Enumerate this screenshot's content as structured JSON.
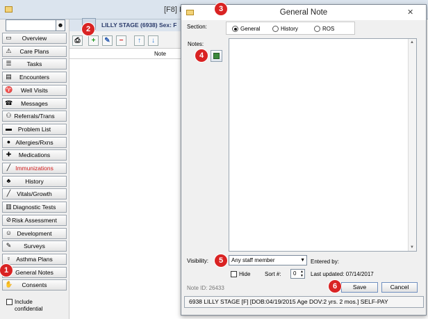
{
  "window": {
    "title": "[F8] L"
  },
  "sidebar": {
    "search_value": "",
    "items": [
      {
        "label": "Overview",
        "icon": "folder-icon",
        "color": "#000000"
      },
      {
        "label": "Care Plans",
        "icon": "warning-icon",
        "color": "#000000"
      },
      {
        "label": "Tasks",
        "icon": "task-list-icon",
        "color": "#000000"
      },
      {
        "label": "Encounters",
        "icon": "clipboard-icon",
        "color": "#000000"
      },
      {
        "label": "Well Visits",
        "icon": "stethoscope-icon",
        "color": "#000000"
      },
      {
        "label": "Messages",
        "icon": "phone-icon",
        "color": "#000000"
      },
      {
        "label": "Referrals/Trans",
        "icon": "people-icon",
        "color": "#000000"
      },
      {
        "label": "Problem List",
        "icon": "list-icon",
        "color": "#000000"
      },
      {
        "label": "Allergies/Rxns",
        "icon": "allergy-icon",
        "color": "#000000"
      },
      {
        "label": "Medications",
        "icon": "pill-icon",
        "color": "#000000"
      },
      {
        "label": "Immunizations",
        "icon": "syringe-icon",
        "color": "#d21b1b"
      },
      {
        "label": "History",
        "icon": "tree-icon",
        "color": "#000000"
      },
      {
        "label": "Vitals/Growth",
        "icon": "ruler-icon",
        "color": "#000000"
      },
      {
        "label": "Diagnostic Tests",
        "icon": "test-tubes-icon",
        "color": "#000000"
      },
      {
        "label": "Risk Assessment",
        "icon": "no-sign-icon",
        "color": "#000000"
      },
      {
        "label": "Development",
        "icon": "child-icon",
        "color": "#000000"
      },
      {
        "label": "Surveys",
        "icon": "survey-icon",
        "color": "#000000"
      },
      {
        "label": "Asthma Plans",
        "icon": "inhaler-icon",
        "color": "#000000"
      },
      {
        "label": "General Notes",
        "icon": "note-icon",
        "color": "#000000"
      },
      {
        "label": "Consents",
        "icon": "hand-icon",
        "color": "#000000"
      }
    ],
    "include_confidential": "Include confidential"
  },
  "patient_strip": {
    "name": "LILLY STAGE (6938)  Sex: F"
  },
  "grid": {
    "column_note": "Note"
  },
  "badges": [
    "1",
    "2",
    "3",
    "4",
    "5",
    "6"
  ],
  "dialog": {
    "title": "General Note",
    "close": "✕",
    "section_label": "Section:",
    "section_options": [
      "General",
      "History",
      "ROS"
    ],
    "section_selected": "General",
    "notes_label": "Notes:",
    "notes_value": "",
    "visibility_label": "Visibility:",
    "visibility_value": "Any staff member",
    "entered_by": "Entered by:",
    "hide_label": "Hide",
    "sort_label": "Sort #:",
    "sort_value": "0",
    "last_updated": "Last updated: 07/14/2017",
    "note_id": "Note ID: 26433",
    "save": "Save",
    "cancel": "Cancel",
    "status": "6938 LILLY STAGE [F] [DOB:04/19/2015  Age DOV:2 yrs. 2 mos.] SELF-PAY"
  }
}
